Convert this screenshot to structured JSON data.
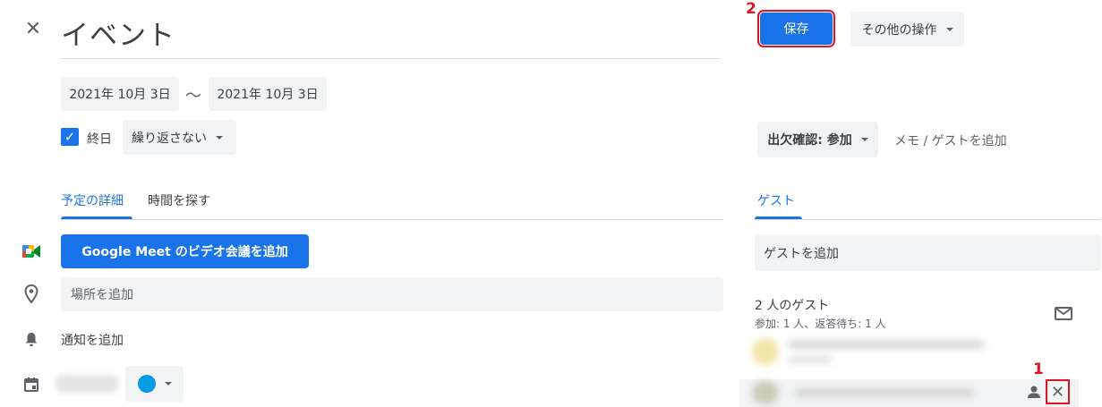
{
  "header": {
    "title": "イベント"
  },
  "dates": {
    "start": "2021年 10月 3日",
    "separator": "〜",
    "end": "2021年 10月 3日"
  },
  "allday": {
    "label": "終日",
    "checked": true
  },
  "repeat": {
    "label": "繰り返さない"
  },
  "tabs": [
    {
      "label": "予定の詳細",
      "active": true
    },
    {
      "label": "時間を探す",
      "active": false
    }
  ],
  "meet": {
    "label": "Google Meet のビデオ会議を追加"
  },
  "location": {
    "placeholder": "場所を追加"
  },
  "notification": {
    "label": "通知を追加"
  },
  "toolbar": {
    "save_label": "保存",
    "more_label": "その他の操作"
  },
  "annotations": {
    "save_badge": "2",
    "remove_badge": "1"
  },
  "rsvp": {
    "label": "出欠確認: 参加",
    "memo_label": "メモ / ゲストを追加"
  },
  "guests": {
    "tab_label": "ゲスト",
    "add_placeholder": "ゲストを追加",
    "count_label": "2 人のゲスト",
    "summary": "参加: 1 人、返答待ち: 1 人"
  },
  "colors": {
    "accent": "#1a73e8",
    "annotation": "#e0141e",
    "event_color": "#039be5"
  },
  "icons": [
    "close-icon",
    "google-meet-icon",
    "location-pin-icon",
    "bell-icon",
    "calendar-icon",
    "mail-icon",
    "person-icon",
    "remove-icon"
  ]
}
